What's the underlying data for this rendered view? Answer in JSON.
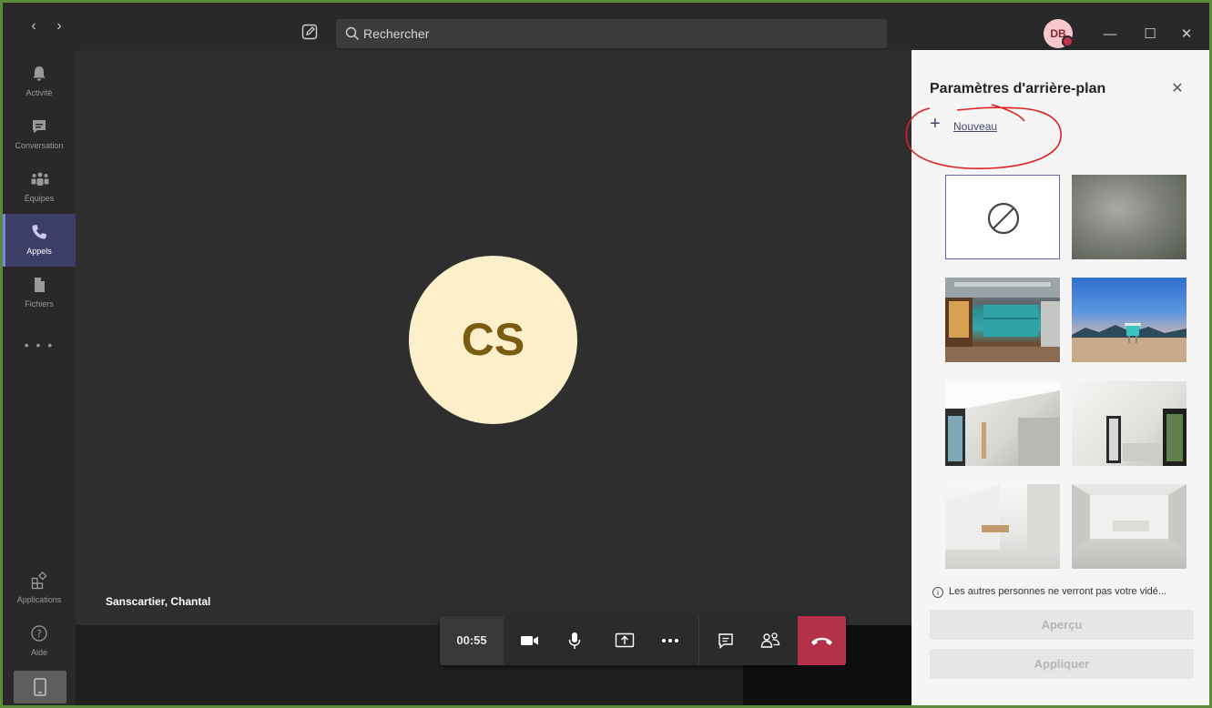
{
  "search": {
    "placeholder": "Rechercher"
  },
  "user": {
    "initials": "DB"
  },
  "window_controls": {
    "minimize": "—",
    "maximize": "☐",
    "close": "✕"
  },
  "rail": {
    "items": [
      {
        "label": "Activité",
        "icon": "bell-icon"
      },
      {
        "label": "Conversation",
        "icon": "chat-icon"
      },
      {
        "label": "Équipes",
        "icon": "teams-icon"
      },
      {
        "label": "Appels",
        "icon": "phone-icon",
        "active": true
      },
      {
        "label": "Fichiers",
        "icon": "file-icon"
      }
    ],
    "more": "• • •",
    "bottom": [
      {
        "label": "Applications",
        "icon": "apps-icon"
      },
      {
        "label": "Aide",
        "icon": "help-icon"
      }
    ]
  },
  "call": {
    "participant_initials": "CS",
    "participant_name": "Sanscartier, Chantal",
    "timer": "00:55"
  },
  "panel": {
    "title": "Paramètres d'arrière-plan",
    "new_label": "Nouveau",
    "note": "Les autres personnes ne verront pas votre vidé...",
    "preview_label": "Aperçu",
    "apply_label": "Appliquer"
  },
  "colors": {
    "accent": "#6264a7",
    "hangup": "#b3324a",
    "avatar_bg": "#fdefc9",
    "avatar_text": "#7a5b12",
    "annotation": "#e02020"
  }
}
